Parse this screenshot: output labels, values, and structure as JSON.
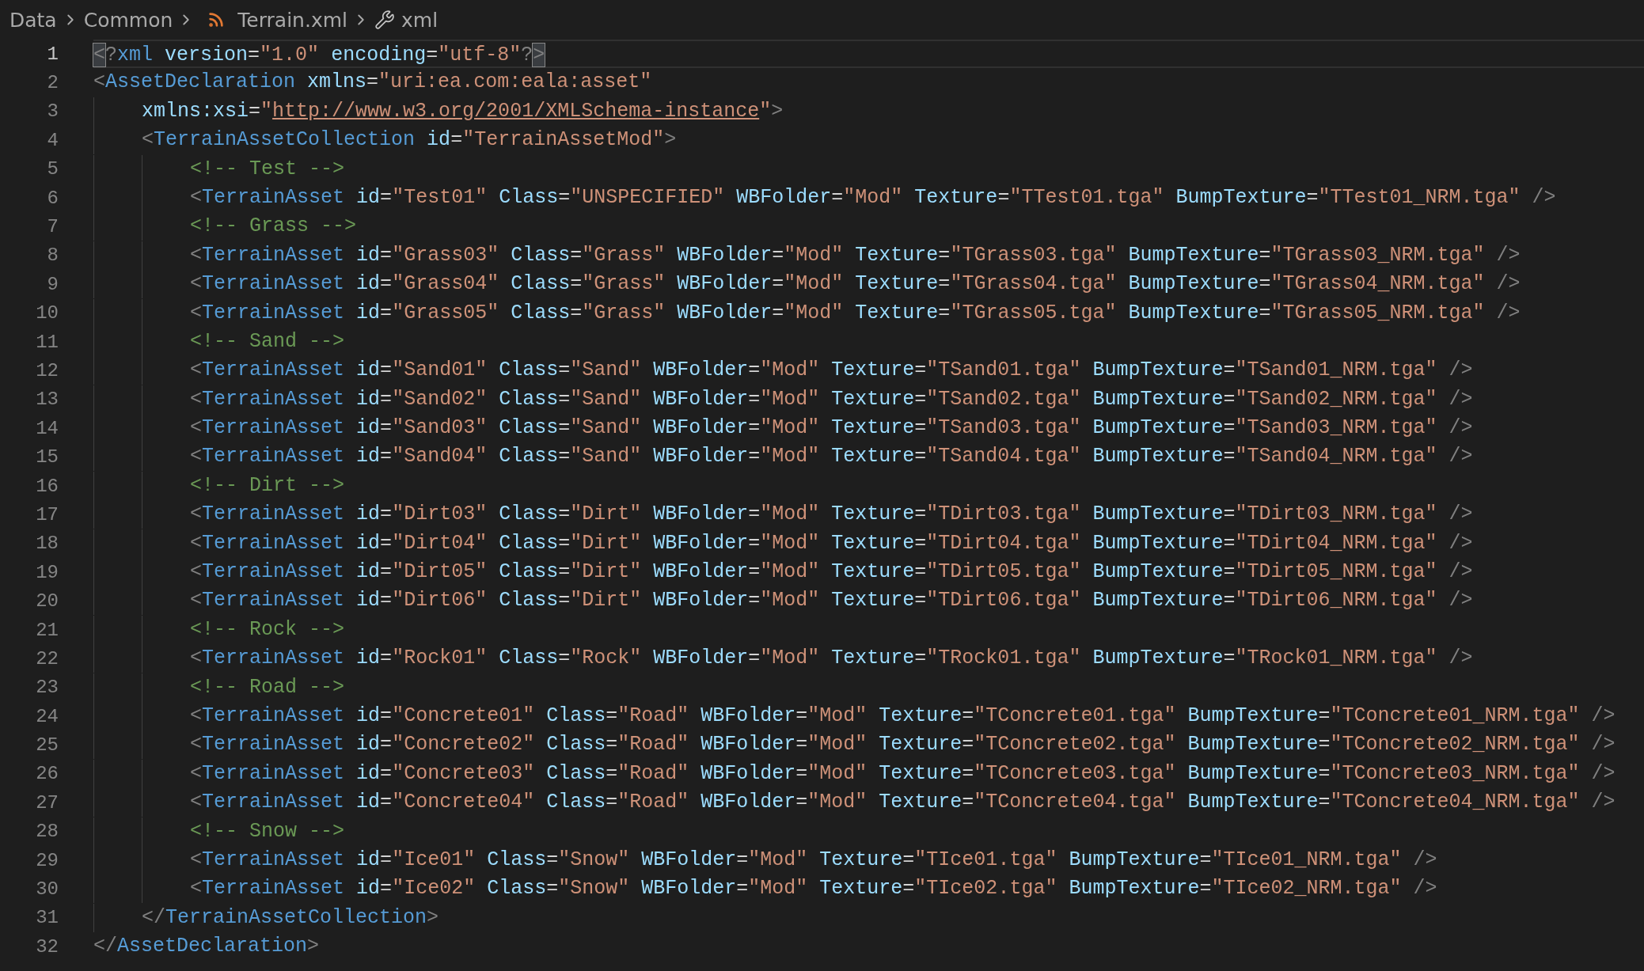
{
  "breadcrumb": [
    {
      "kind": "folder",
      "label": "Data"
    },
    {
      "kind": "folder",
      "label": "Common"
    },
    {
      "kind": "file",
      "label": "Terrain.xml"
    },
    {
      "kind": "symbol",
      "label": "xml"
    }
  ],
  "editor": {
    "lines": [
      {
        "number": "1",
        "current": true,
        "bracket_match": true,
        "text": "<?xml version=\"1.0\" encoding=\"utf-8\"?>"
      },
      {
        "number": "2",
        "current": false,
        "bracket_match": false,
        "text": "<AssetDeclaration xmlns=\"uri:ea.com:eala:asset\""
      },
      {
        "number": "3",
        "current": false,
        "bracket_match": false,
        "text": "    xmlns:xsi=\"http://www.w3.org/2001/XMLSchema-instance\">"
      },
      {
        "number": "4",
        "current": false,
        "bracket_match": false,
        "text": "    <TerrainAssetCollection id=\"TerrainAssetMod\">"
      },
      {
        "number": "5",
        "current": false,
        "bracket_match": false,
        "text": "        <!-- Test -->"
      },
      {
        "number": "6",
        "current": false,
        "bracket_match": false,
        "text": "        <TerrainAsset id=\"Test01\" Class=\"UNSPECIFIED\" WBFolder=\"Mod\" Texture=\"TTest01.tga\" BumpTexture=\"TTest01_NRM.tga\" />"
      },
      {
        "number": "7",
        "current": false,
        "bracket_match": false,
        "text": "        <!-- Grass -->"
      },
      {
        "number": "8",
        "current": false,
        "bracket_match": false,
        "text": "        <TerrainAsset id=\"Grass03\" Class=\"Grass\" WBFolder=\"Mod\" Texture=\"TGrass03.tga\" BumpTexture=\"TGrass03_NRM.tga\" />"
      },
      {
        "number": "9",
        "current": false,
        "bracket_match": false,
        "text": "        <TerrainAsset id=\"Grass04\" Class=\"Grass\" WBFolder=\"Mod\" Texture=\"TGrass04.tga\" BumpTexture=\"TGrass04_NRM.tga\" />"
      },
      {
        "number": "10",
        "current": false,
        "bracket_match": false,
        "text": "        <TerrainAsset id=\"Grass05\" Class=\"Grass\" WBFolder=\"Mod\" Texture=\"TGrass05.tga\" BumpTexture=\"TGrass05_NRM.tga\" />"
      },
      {
        "number": "11",
        "current": false,
        "bracket_match": false,
        "text": "        <!-- Sand -->"
      },
      {
        "number": "12",
        "current": false,
        "bracket_match": false,
        "text": "        <TerrainAsset id=\"Sand01\" Class=\"Sand\" WBFolder=\"Mod\" Texture=\"TSand01.tga\" BumpTexture=\"TSand01_NRM.tga\" />"
      },
      {
        "number": "13",
        "current": false,
        "bracket_match": false,
        "text": "        <TerrainAsset id=\"Sand02\" Class=\"Sand\" WBFolder=\"Mod\" Texture=\"TSand02.tga\" BumpTexture=\"TSand02_NRM.tga\" />"
      },
      {
        "number": "14",
        "current": false,
        "bracket_match": false,
        "text": "        <TerrainAsset id=\"Sand03\" Class=\"Sand\" WBFolder=\"Mod\" Texture=\"TSand03.tga\" BumpTexture=\"TSand03_NRM.tga\" />"
      },
      {
        "number": "15",
        "current": false,
        "bracket_match": false,
        "text": "        <TerrainAsset id=\"Sand04\" Class=\"Sand\" WBFolder=\"Mod\" Texture=\"TSand04.tga\" BumpTexture=\"TSand04_NRM.tga\" />"
      },
      {
        "number": "16",
        "current": false,
        "bracket_match": false,
        "text": "        <!-- Dirt -->"
      },
      {
        "number": "17",
        "current": false,
        "bracket_match": false,
        "text": "        <TerrainAsset id=\"Dirt03\" Class=\"Dirt\" WBFolder=\"Mod\" Texture=\"TDirt03.tga\" BumpTexture=\"TDirt03_NRM.tga\" />"
      },
      {
        "number": "18",
        "current": false,
        "bracket_match": false,
        "text": "        <TerrainAsset id=\"Dirt04\" Class=\"Dirt\" WBFolder=\"Mod\" Texture=\"TDirt04.tga\" BumpTexture=\"TDirt04_NRM.tga\" />"
      },
      {
        "number": "19",
        "current": false,
        "bracket_match": false,
        "text": "        <TerrainAsset id=\"Dirt05\" Class=\"Dirt\" WBFolder=\"Mod\" Texture=\"TDirt05.tga\" BumpTexture=\"TDirt05_NRM.tga\" />"
      },
      {
        "number": "20",
        "current": false,
        "bracket_match": false,
        "text": "        <TerrainAsset id=\"Dirt06\" Class=\"Dirt\" WBFolder=\"Mod\" Texture=\"TDirt06.tga\" BumpTexture=\"TDirt06_NRM.tga\" />"
      },
      {
        "number": "21",
        "current": false,
        "bracket_match": false,
        "text": "        <!-- Rock -->"
      },
      {
        "number": "22",
        "current": false,
        "bracket_match": false,
        "text": "        <TerrainAsset id=\"Rock01\" Class=\"Rock\" WBFolder=\"Mod\" Texture=\"TRock01.tga\" BumpTexture=\"TRock01_NRM.tga\" />"
      },
      {
        "number": "23",
        "current": false,
        "bracket_match": false,
        "text": "        <!-- Road -->"
      },
      {
        "number": "24",
        "current": false,
        "bracket_match": false,
        "text": "        <TerrainAsset id=\"Concrete01\" Class=\"Road\" WBFolder=\"Mod\" Texture=\"TConcrete01.tga\" BumpTexture=\"TConcrete01_NRM.tga\" />"
      },
      {
        "number": "25",
        "current": false,
        "bracket_match": false,
        "text": "        <TerrainAsset id=\"Concrete02\" Class=\"Road\" WBFolder=\"Mod\" Texture=\"TConcrete02.tga\" BumpTexture=\"TConcrete02_NRM.tga\" />"
      },
      {
        "number": "26",
        "current": false,
        "bracket_match": false,
        "text": "        <TerrainAsset id=\"Concrete03\" Class=\"Road\" WBFolder=\"Mod\" Texture=\"TConcrete03.tga\" BumpTexture=\"TConcrete03_NRM.tga\" />"
      },
      {
        "number": "27",
        "current": false,
        "bracket_match": false,
        "text": "        <TerrainAsset id=\"Concrete04\" Class=\"Road\" WBFolder=\"Mod\" Texture=\"TConcrete04.tga\" BumpTexture=\"TConcrete04_NRM.tga\" />"
      },
      {
        "number": "28",
        "current": false,
        "bracket_match": false,
        "text": "        <!-- Snow -->"
      },
      {
        "number": "29",
        "current": false,
        "bracket_match": false,
        "text": "        <TerrainAsset id=\"Ice01\" Class=\"Snow\" WBFolder=\"Mod\" Texture=\"TIce01.tga\" BumpTexture=\"TIce01_NRM.tga\" />"
      },
      {
        "number": "30",
        "current": false,
        "bracket_match": false,
        "text": "        <TerrainAsset id=\"Ice02\" Class=\"Snow\" WBFolder=\"Mod\" Texture=\"TIce02.tga\" BumpTexture=\"TIce02_NRM.tga\" />"
      },
      {
        "number": "31",
        "current": false,
        "bracket_match": false,
        "text": "    </TerrainAssetCollection>"
      },
      {
        "number": "32",
        "current": false,
        "bracket_match": false,
        "text": "</AssetDeclaration>"
      }
    ]
  }
}
